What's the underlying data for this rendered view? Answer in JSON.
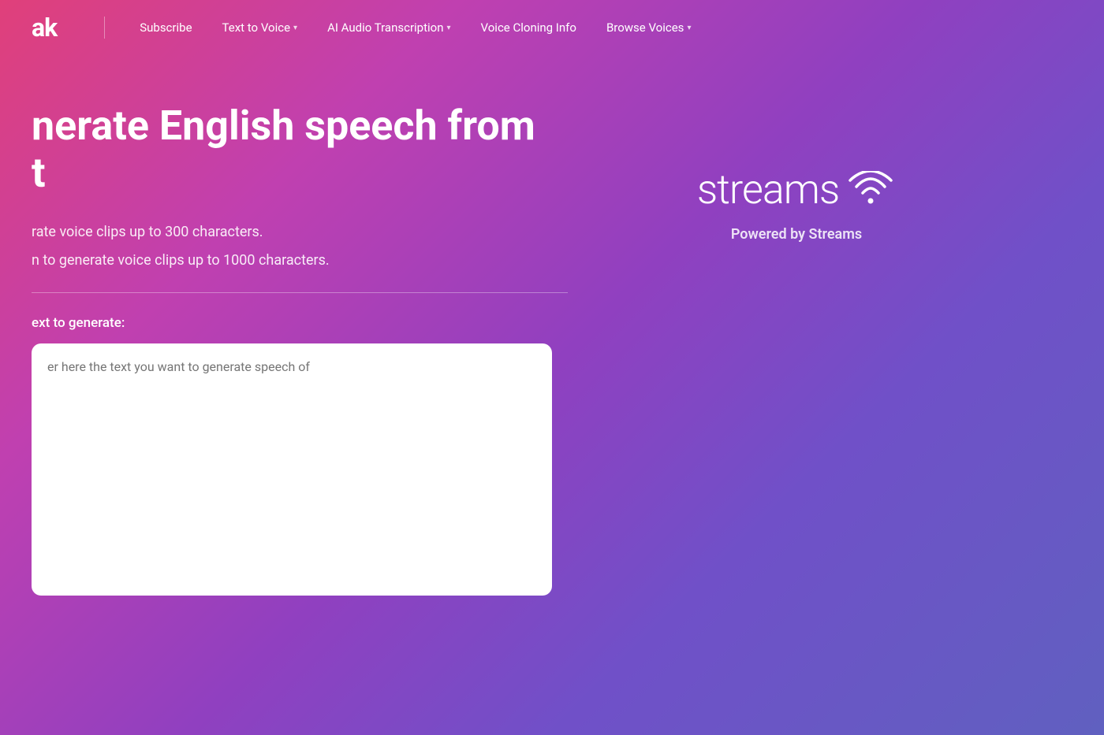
{
  "logo": {
    "text": "ak"
  },
  "navbar": {
    "subscribe_label": "Subscribe",
    "nav_items": [
      {
        "label": "Text to Voice",
        "has_dropdown": true
      },
      {
        "label": "AI Audio Transcription",
        "has_dropdown": true
      },
      {
        "label": "Voice Cloning Info",
        "has_dropdown": false
      },
      {
        "label": "Browse Voices",
        "has_dropdown": true
      }
    ]
  },
  "hero": {
    "title_line1": "nerate English speech from",
    "title_line2": "t",
    "subtitle_line1": "rate voice clips up to 300 characters.",
    "subtitle_line2": "n to generate voice clips up to 1000 characters.",
    "text_label": "ext to generate:",
    "textarea_placeholder": "er here the text you want to generate speech of"
  },
  "branding": {
    "streams_text": "streams",
    "powered_by_prefix": "Powered by ",
    "powered_by_brand": "Streams"
  },
  "colors": {
    "background_start": "#e0407a",
    "background_end": "#6060c0",
    "text_primary": "#ffffff"
  }
}
